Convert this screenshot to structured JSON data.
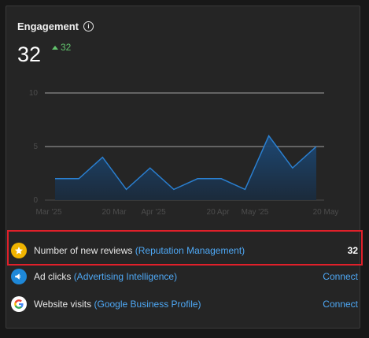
{
  "widget": {
    "title": "Engagement",
    "info_icon": "info-icon",
    "total": "32",
    "delta": "32",
    "delta_color": "#62c36d"
  },
  "chart_data": {
    "type": "area",
    "x_tick_labels": [
      "Mar '25",
      "20 Mar",
      "Apr '25",
      "20 Apr",
      "May '25",
      "20 May"
    ],
    "y_ticks": [
      0,
      5,
      10
    ],
    "ylim": [
      0,
      10
    ],
    "values": [
      2,
      2,
      4,
      1,
      3,
      1,
      2,
      2,
      1,
      6,
      3,
      5
    ],
    "line_color": "#2a7fd0",
    "fill_color": "#1d4a78",
    "grid": true
  },
  "metrics": [
    {
      "icon": "star-icon",
      "label": "Number of new reviews",
      "source": "(Reputation Management)",
      "value": "32",
      "highlighted": true
    },
    {
      "icon": "megaphone-icon",
      "label": "Ad clicks",
      "source": "(Advertising Intelligence)",
      "value": "Connect"
    },
    {
      "icon": "google-icon",
      "label": "Website visits",
      "source": "(Google Business Profile)",
      "value": "Connect"
    }
  ],
  "colors": {
    "accent_link": "#4ea8f5",
    "highlight_border": "#e0202a",
    "star_badge": "#f0b400",
    "ads_badge": "#1e88d8"
  }
}
